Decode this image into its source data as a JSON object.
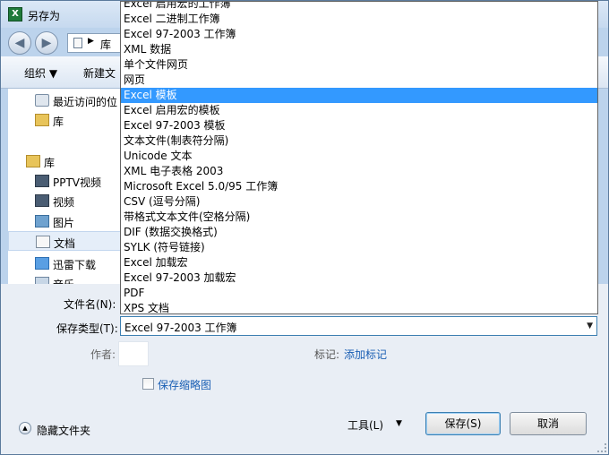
{
  "window": {
    "title": "另存为",
    "app_icon_glyph": "X",
    "accent_color": "#3399ff"
  },
  "navbar": {
    "back_glyph": "◀",
    "forward_glyph": "▶",
    "address_arrow": "▶",
    "address_crumb": "库"
  },
  "toolbar": {
    "organize_label": "组织 ▼",
    "new_folder_label": "新建文"
  },
  "sidebar": {
    "items": [
      {
        "label": "最近访问的位",
        "icon": "recent-places-icon"
      },
      {
        "label": "库",
        "icon": "folder-icon"
      },
      {
        "label": "库",
        "icon": "libraries-icon"
      },
      {
        "label": "PPTV视频",
        "icon": "video-icon"
      },
      {
        "label": "视频",
        "icon": "video-icon"
      },
      {
        "label": "图片",
        "icon": "picture-icon"
      },
      {
        "label": "文档",
        "icon": "document-icon"
      },
      {
        "label": "迅雷下载",
        "icon": "download-icon"
      },
      {
        "label": "音乐",
        "icon": "music-icon"
      }
    ]
  },
  "form": {
    "filename_label": "文件名(N):",
    "filetype_label": "保存类型(T):",
    "filetype_value": "Excel 97-2003 工作簿",
    "author_label": "作者:",
    "tags_label": "标记:",
    "add_tag_link": "添加标记",
    "thumbnail_checkbox_label": "保存缩略图"
  },
  "footer": {
    "hide_folders_label": "隐藏文件夹",
    "tools_label": "工具(L)",
    "tools_arrow": "▼",
    "save_label": "保存(S)",
    "cancel_label": "取消"
  },
  "dropdown": {
    "selected_index": 6,
    "options": [
      "Excel 启用宏的工作簿",
      "Excel 二进制工作簿",
      "Excel 97-2003 工作簿",
      "XML 数据",
      "单个文件网页",
      "网页",
      "Excel 模板",
      "Excel 启用宏的模板",
      "Excel 97-2003 模板",
      "文本文件(制表符分隔)",
      "Unicode 文本",
      "XML 电子表格 2003",
      "Microsoft Excel 5.0/95 工作簿",
      "CSV (逗号分隔)",
      "带格式文本文件(空格分隔)",
      "DIF (数据交换格式)",
      "SYLK (符号链接)",
      "Excel 加载宏",
      "Excel 97-2003 加载宏",
      "PDF",
      "XPS 文档"
    ]
  }
}
